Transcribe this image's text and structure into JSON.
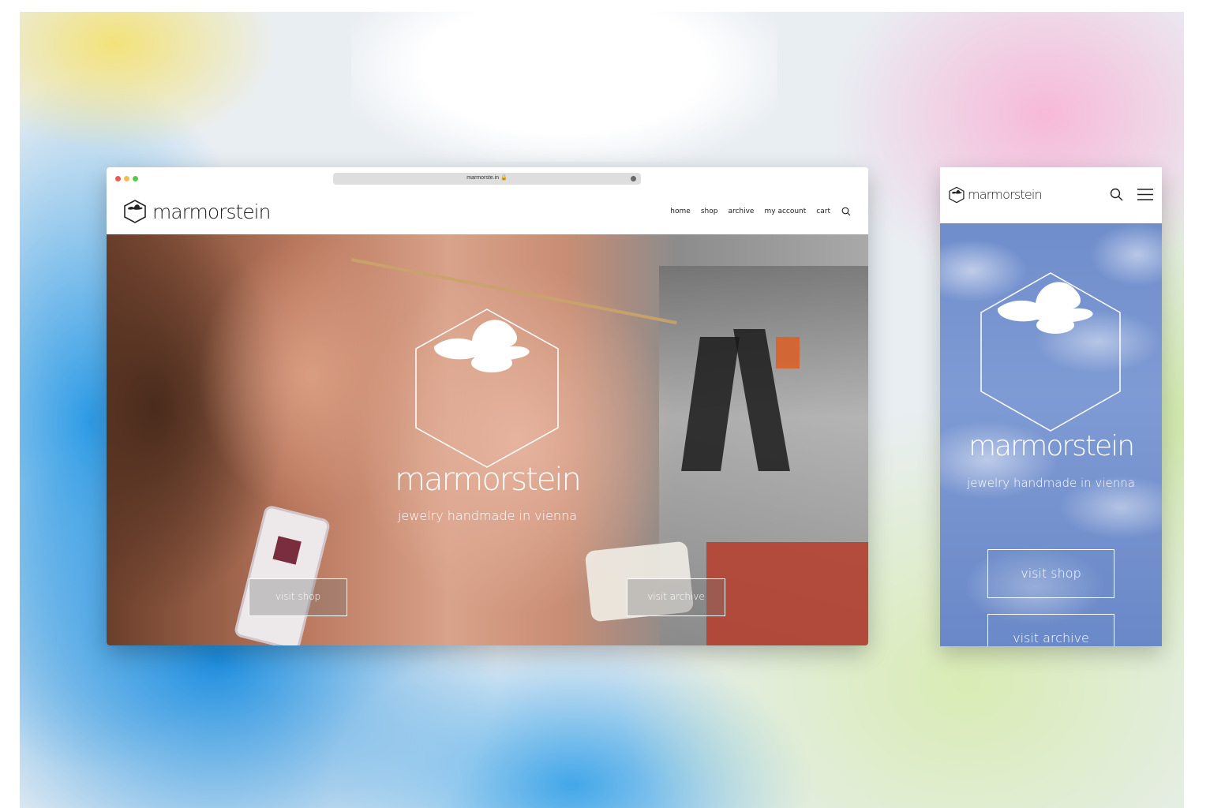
{
  "colors": {
    "accent_white": "#ffffff",
    "mobile_sky": "#7f9bd4",
    "nav_text": "#222222"
  },
  "browser": {
    "url": "marmorste.in 🔒"
  },
  "site": {
    "logo_text": "marmorstein",
    "nav": {
      "home": "home",
      "shop": "shop",
      "archive": "archive",
      "account": "my account",
      "cart": "cart",
      "search_icon": "search-icon"
    },
    "hero": {
      "title": "marmorstein",
      "subtitle": "jewelry handmade in vienna",
      "visit_shop": "visit shop",
      "visit_archive": "visit archive"
    }
  },
  "mobile": {
    "logo_text": "marmorstein",
    "search_icon": "search-icon",
    "menu_icon": "hamburger-menu-icon",
    "hero": {
      "title": "marmorstein",
      "subtitle": "jewelry handmade in vienna",
      "visit_shop": "visit shop",
      "visit_archive": "visit archive"
    }
  }
}
